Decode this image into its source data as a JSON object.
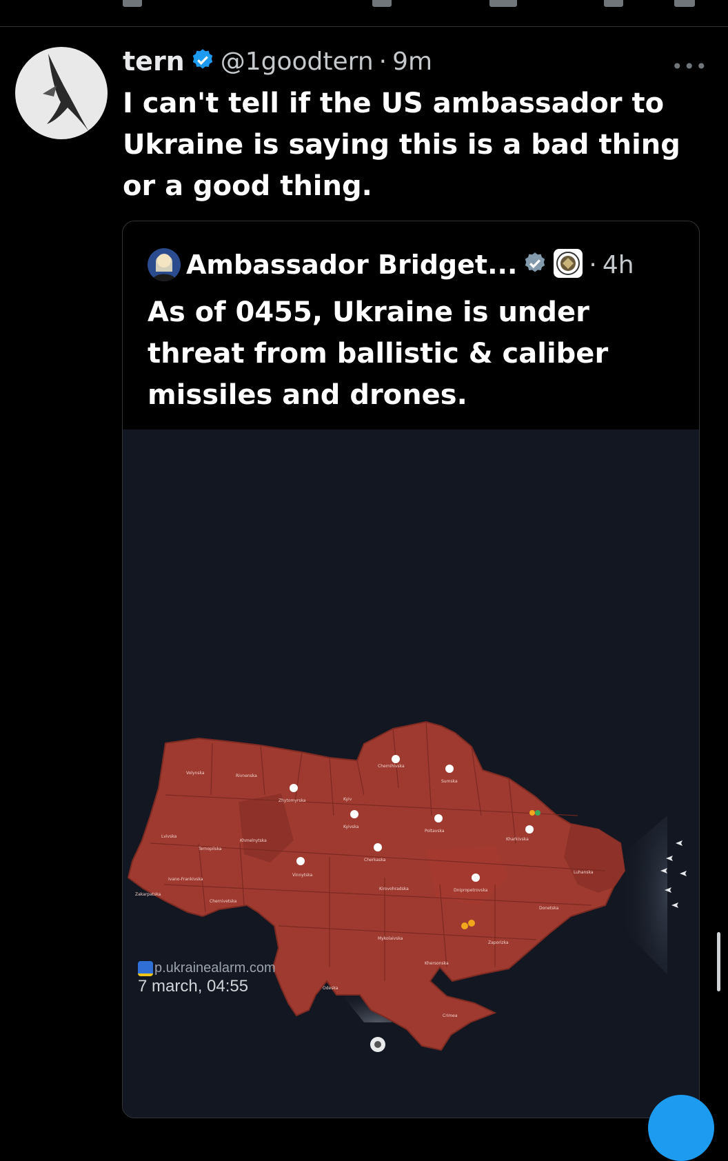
{
  "tweet": {
    "author_name": "tern",
    "author_handle": "@1goodtern",
    "separator": "·",
    "time": "9m",
    "more_icon": "more-icon",
    "text": "I can't tell if the US ambassador to Ukraine is saying this is a bad thing or a good thing."
  },
  "quote": {
    "author_name": "Ambassador Bridget...",
    "separator": "·",
    "time": "4h",
    "text": "As of 0455, Ukraine is under threat from ballistic & caliber missiles and drones.",
    "map": {
      "source": "p.ukrainealarm.com",
      "date": "7 march, 04:55",
      "alert_color": "#9e3a30",
      "background_color": "#121721",
      "regions": [
        "Volynska",
        "Rivnenska",
        "Zhytomyrska",
        "Kyiv",
        "Kyivska",
        "Chernihivska",
        "Sumska",
        "Lvivska",
        "Ternopilska",
        "Khmelnytska",
        "Vinnytska",
        "Cherkaska",
        "Poltavska",
        "Kharkivska",
        "Luhanska",
        "Ivano-Frankivska",
        "Zakarpatska",
        "Chernivetska",
        "Kirovohradska",
        "Dnipropetrovska",
        "Donetska",
        "Mykolaivska",
        "Zaporizka",
        "Khersonska",
        "Odeska",
        "Crimea"
      ]
    }
  },
  "colors": {
    "background": "#000000",
    "text_primary": "#e7e9ea",
    "text_secondary": "#71767b",
    "verified_blue": "#1d9bf0",
    "verified_gray": "#829aab"
  }
}
